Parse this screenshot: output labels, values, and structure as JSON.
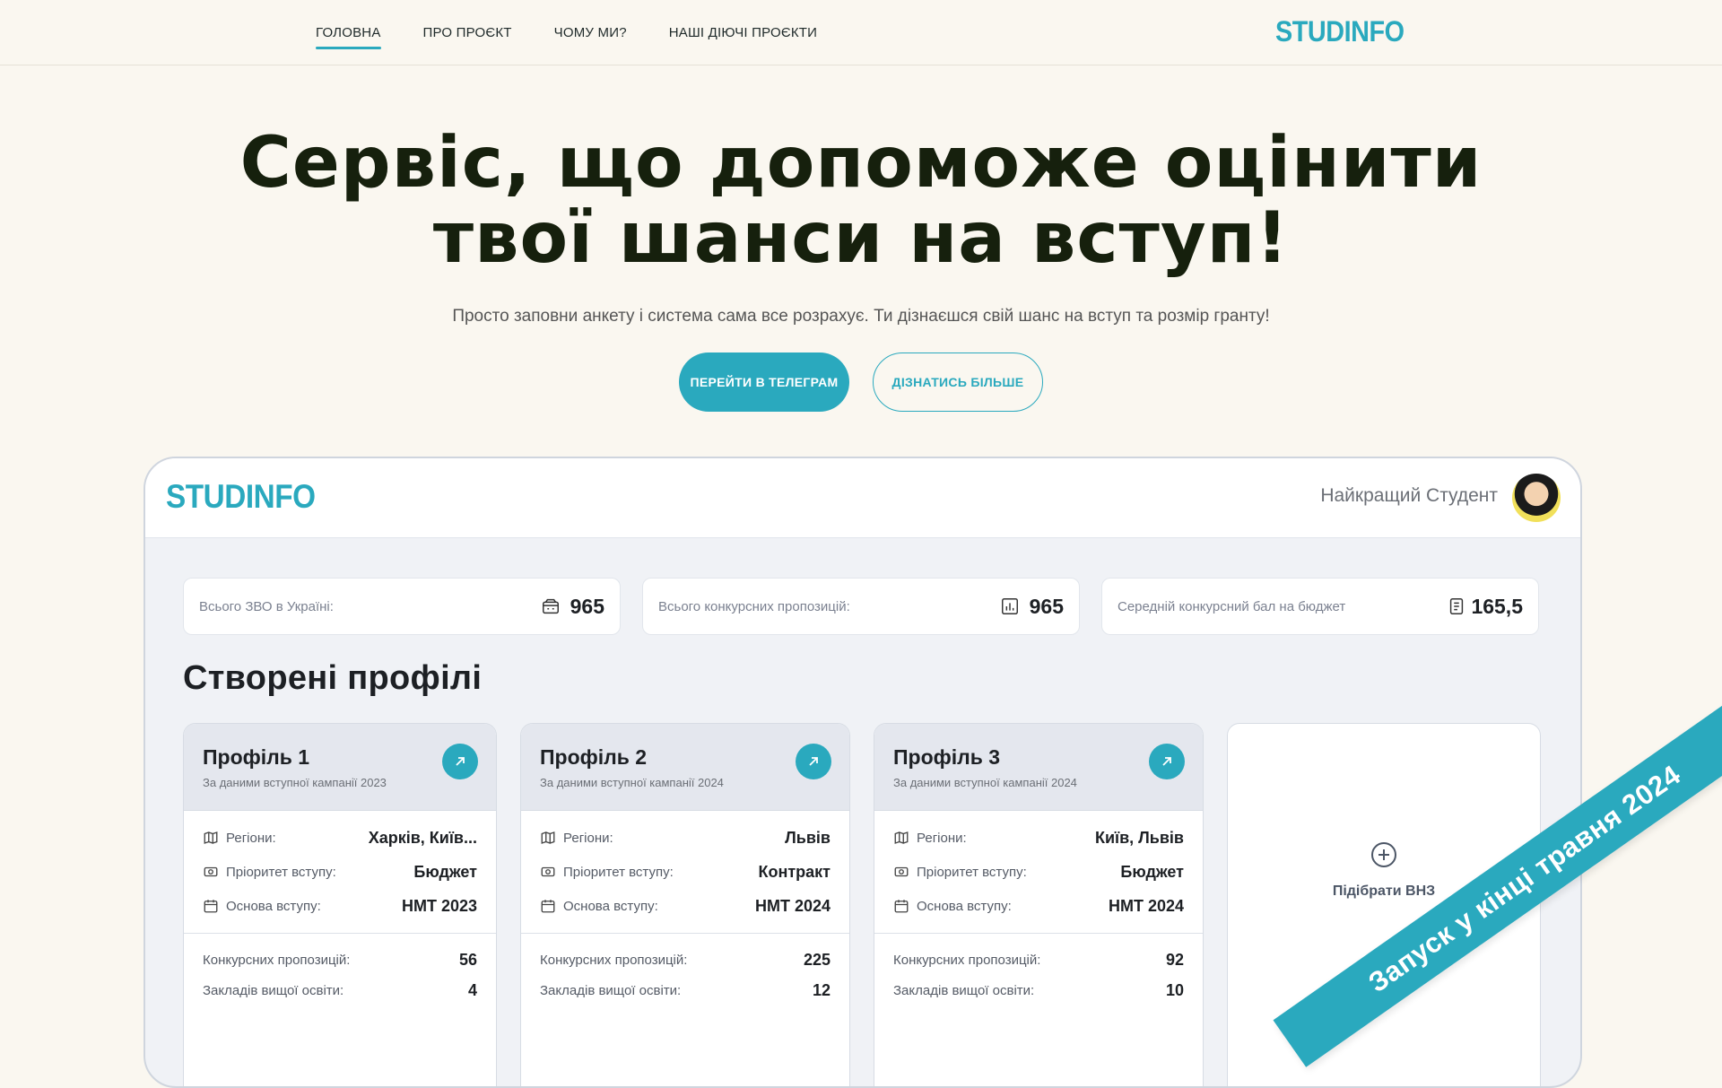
{
  "nav": {
    "items": [
      "ГОЛОВНА",
      "ПРО ПРОЄКТ",
      "ЧОМУ МИ?",
      "НАШІ ДІЮЧІ ПРОЄКТИ"
    ],
    "brand": "STUDINFO"
  },
  "hero": {
    "title_line1": "Сервіс, що допоможе оцінити",
    "title_line2": "твої шанси на вступ!",
    "subtitle": "Просто заповни анкету і система сама все розрахує. Ти дізнаєшся свій шанс на вступ та розмір гранту!",
    "primary_button": "ПЕРЕЙТИ В ТЕЛЕГРАМ",
    "secondary_button": "ДІЗНАТИСЬ БІЛЬШЕ"
  },
  "mock": {
    "logo": "STUDINFO",
    "user_name": "Найкращий Студент",
    "stats": [
      {
        "label": "Всього ЗВО в Україні:",
        "value": "965",
        "icon": "building-icon"
      },
      {
        "label": "Всього конкурсних пропозицій:",
        "value": "965",
        "icon": "chart-icon"
      },
      {
        "label": "Середній конкурсний бал на бюджет",
        "value": "165,5",
        "icon": "document-icon"
      }
    ],
    "section_title": "Створені профілі",
    "row_labels": {
      "regions": "Регіони:",
      "priority": "Пріоритет вступу:",
      "basis": "Основа вступу:",
      "offers": "Конкурсних пропозицій:",
      "institutions": "Закладів вищої освіти:"
    },
    "profiles": [
      {
        "title": "Профіль 1",
        "subtitle": "За даними вступної кампанії 2023",
        "regions": "Харків, Київ...",
        "priority": "Бюджет",
        "basis": "НМТ 2023",
        "offers": "56",
        "institutions": "4"
      },
      {
        "title": "Профіль 2",
        "subtitle": "За даними вступної кампанії 2024",
        "regions": "Львів",
        "priority": "Контракт",
        "basis": "НМТ 2024",
        "offers": "225",
        "institutions": "12"
      },
      {
        "title": "Профіль 3",
        "subtitle": "За даними вступної кампанії 2024",
        "regions": "Київ, Львів",
        "priority": "Бюджет",
        "basis": "НМТ 2024",
        "offers": "92",
        "institutions": "10"
      }
    ],
    "add_label": "Підібрати ВНЗ"
  },
  "ribbon": "Запуск у кінці травня 2024",
  "colors": {
    "accent": "#2aa9be",
    "background": "#faf7f0",
    "title": "#16200d"
  }
}
